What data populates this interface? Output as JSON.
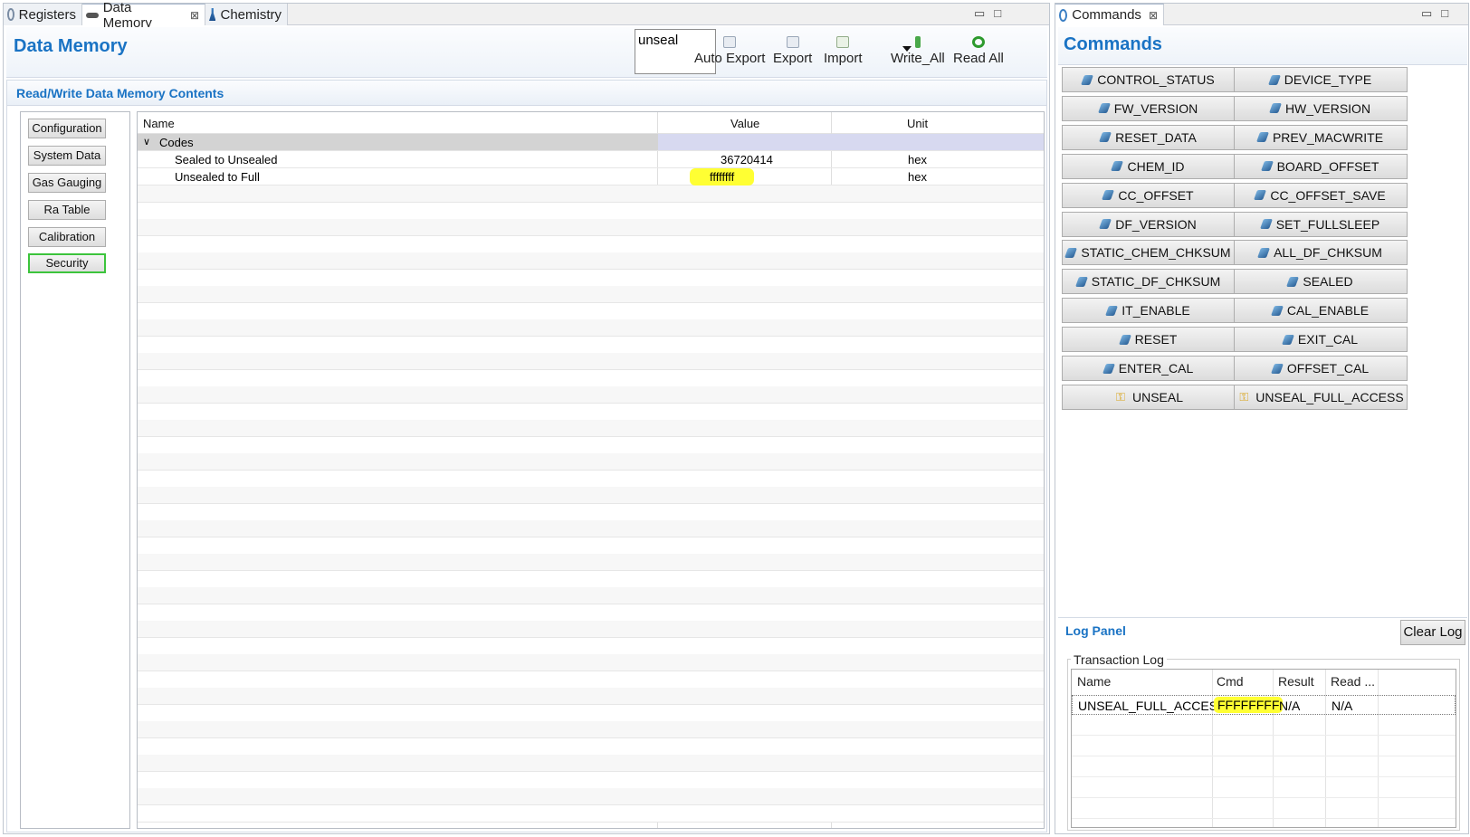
{
  "left_tabs": [
    {
      "label": "Registers",
      "icon": "gear-icon"
    },
    {
      "label": "Data Memory",
      "icon": "battery-icon"
    },
    {
      "label": "Chemistry",
      "icon": "flask-icon"
    }
  ],
  "data_memory": {
    "title": "Data Memory",
    "search_value": "unseal",
    "toolbar": {
      "auto_export": "Auto Export",
      "export": "Export",
      "import": "Import",
      "write_all": "Write_All",
      "read_all": "Read All"
    },
    "section_title": "Read/Write Data Memory Contents",
    "categories": [
      "Configuration",
      "System Data",
      "Gas Gauging",
      "Ra Table",
      "Calibration",
      "Security"
    ],
    "selected_category": "Security",
    "table": {
      "columns": [
        "Name",
        "Value",
        "Unit"
      ],
      "group": "Codes",
      "rows": [
        {
          "name": "Sealed to Unsealed",
          "value": "36720414",
          "unit": "hex"
        },
        {
          "name": "Unsealed to Full",
          "value": "ffffffff",
          "unit": "hex"
        }
      ]
    }
  },
  "commands_view": {
    "tab_label": "Commands",
    "title": "Commands",
    "buttons": [
      "CONTROL_STATUS",
      "DEVICE_TYPE",
      "FW_VERSION",
      "HW_VERSION",
      "RESET_DATA",
      "PREV_MACWRITE",
      "CHEM_ID",
      "BOARD_OFFSET",
      "CC_OFFSET",
      "CC_OFFSET_SAVE",
      "DF_VERSION",
      "SET_FULLSLEEP",
      "STATIC_CHEM_CHKSUM",
      "ALL_DF_CHKSUM",
      "STATIC_DF_CHKSUM",
      "SEALED",
      "IT_ENABLE",
      "CAL_ENABLE",
      "RESET",
      "EXIT_CAL",
      "ENTER_CAL",
      "OFFSET_CAL",
      "UNSEAL",
      "UNSEAL_FULL_ACCESS"
    ]
  },
  "log_panel": {
    "title": "Log Panel",
    "clear_label": "Clear Log",
    "transaction_label": "Transaction Log",
    "columns": [
      "Name",
      "Cmd",
      "Result",
      "Read ..."
    ],
    "rows": [
      {
        "name": "UNSEAL_FULL_ACCESS",
        "cmd": "FFFFFFFF",
        "result": "N/A",
        "read": "N/A"
      }
    ]
  },
  "colors": {
    "accent": "#1a73c4",
    "highlight": "#ffff33",
    "selected_border": "#3cc43c"
  }
}
